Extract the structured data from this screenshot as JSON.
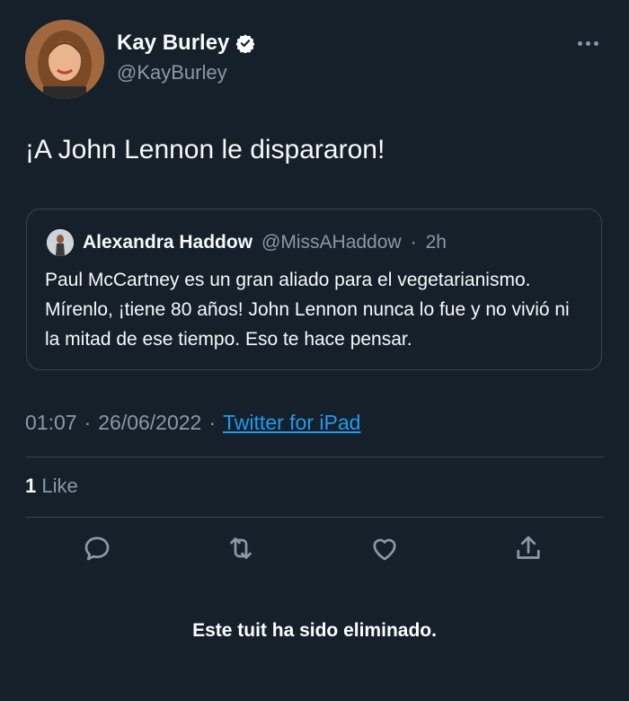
{
  "author": {
    "display_name": "Kay Burley",
    "handle": "@KayBurley",
    "verified": true
  },
  "tweet": {
    "text": "¡A John Lennon le dispararon!"
  },
  "quoted_tweet": {
    "display_name": "Alexandra Haddow",
    "handle": "@MissAHaddow",
    "separator": "·",
    "time": "2h",
    "text": "Paul McCartney es un gran aliado para el vegetarianismo. Mírenlo, ¡tiene 80 años! John Lennon nunca lo fue y no vivió ni la mitad de ese tiempo. Eso te hace pensar."
  },
  "meta": {
    "time": "01:07",
    "separator": "·",
    "date": "26/06/2022",
    "separator2": "·",
    "source": "Twitter for iPad"
  },
  "stats": {
    "like_count": "1",
    "like_label": "Like"
  },
  "actions": [
    "reply-icon",
    "retweet-icon",
    "like-icon",
    "share-icon"
  ],
  "caption": "Este tuit ha sido eliminado.",
  "colors": {
    "background": "#15202b",
    "accent": "#1d9bf0",
    "muted": "#8b98a5",
    "border": "#38444d"
  }
}
